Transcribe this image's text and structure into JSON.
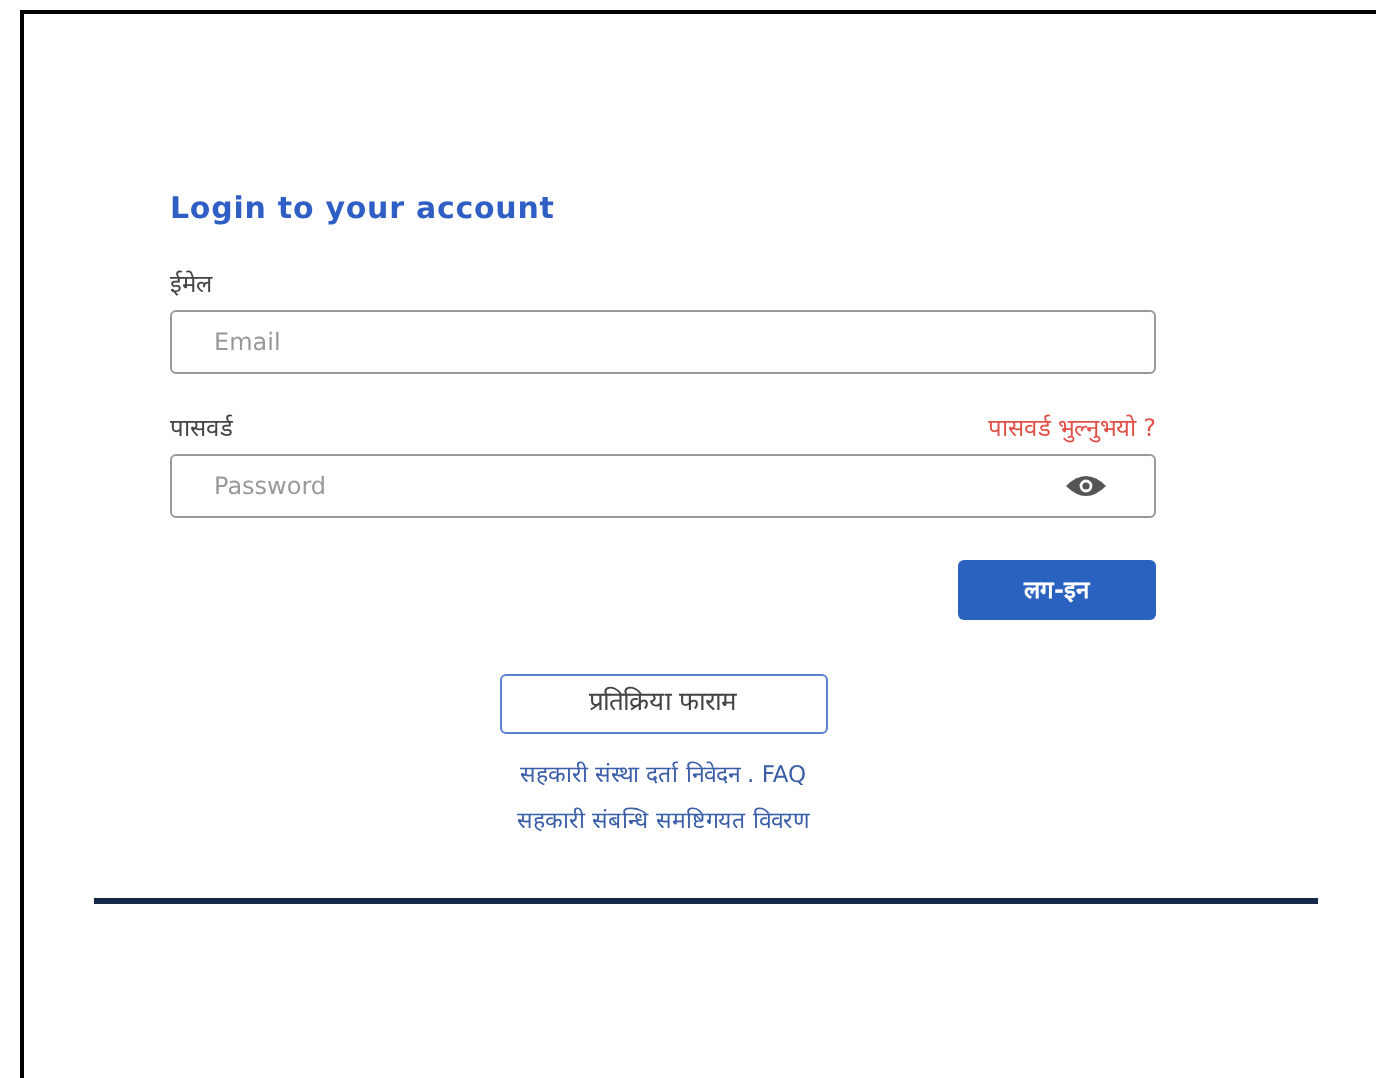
{
  "title": "Login to your account",
  "email": {
    "label": "ईमेल",
    "placeholder": "Email"
  },
  "password": {
    "label": "पासवर्ड",
    "forgot_link": "पासवर्ड भुल्नुभयो ?",
    "placeholder": "Password"
  },
  "login_button": "लग-इन",
  "feedback_button": "प्रतिक्रिया फाराम",
  "links": [
    "सहकारी संस्था दर्ता निवेदन . FAQ",
    "सहकारी संबन्धि समष्टिगयत विवरण"
  ]
}
